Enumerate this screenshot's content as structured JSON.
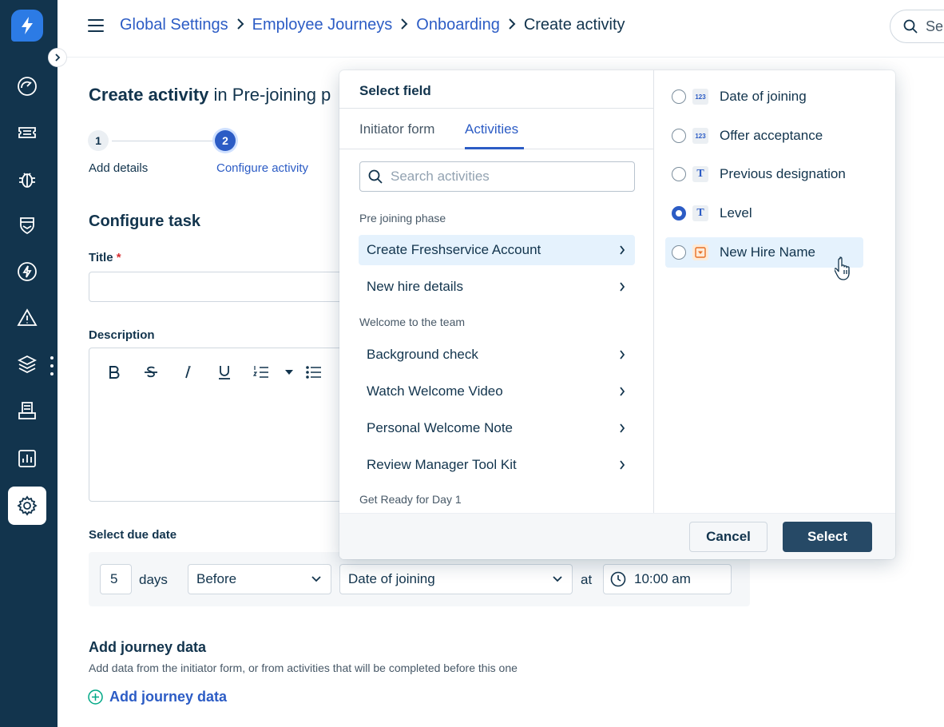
{
  "sidebar": {
    "items": [
      {
        "icon": "dashboard-icon"
      },
      {
        "icon": "tickets-icon"
      },
      {
        "icon": "bug-icon"
      },
      {
        "icon": "shield-icon"
      },
      {
        "icon": "lightning-icon"
      },
      {
        "icon": "alert-icon"
      },
      {
        "icon": "layers-icon"
      },
      {
        "icon": "inbox-icon"
      },
      {
        "icon": "reports-icon"
      },
      {
        "icon": "settings-icon",
        "active": true
      }
    ]
  },
  "header": {
    "breadcrumb": [
      "Global Settings",
      "Employee Journeys",
      "Onboarding"
    ],
    "current": "Create activity",
    "search_text": "Se"
  },
  "page": {
    "title_bold": "Create activity",
    "title_rest": "in Pre-joining p",
    "steps": [
      {
        "number": "1",
        "label": "Add details"
      },
      {
        "number": "2",
        "label": "Configure activity"
      }
    ],
    "section_title": "Configure task",
    "title_label": "Title",
    "required_mark": "*",
    "description_label": "Description",
    "due_date_label": "Select due date",
    "due": {
      "amount": "5",
      "unit": "days",
      "relation": "Before",
      "field": "Date of joining",
      "at": "at",
      "time": "10:00 am"
    },
    "journey": {
      "title": "Add journey data",
      "subtitle": "Add data from the initiator form, or from activities that will be completed before this one",
      "add_label": "Add journey data"
    }
  },
  "popover": {
    "title": "Select field",
    "tabs": [
      "Initiator form",
      "Activities"
    ],
    "active_tab": "Activities",
    "search_placeholder": "Search activities",
    "groups": [
      {
        "label": "Pre joining phase",
        "items": [
          "Create Freshservice Account",
          "New hire details"
        ]
      },
      {
        "label": "Welcome to the team",
        "items": [
          "Background check",
          "Watch Welcome Video",
          "Personal Welcome Note",
          "Review Manager Tool Kit"
        ]
      },
      {
        "label": "Get Ready for Day 1",
        "items": []
      }
    ],
    "fields": [
      {
        "name": "Date of joining",
        "type": "number",
        "type_label": "123",
        "selected": false
      },
      {
        "name": "Offer acceptance",
        "type": "number",
        "type_label": "123",
        "selected": false
      },
      {
        "name": "Previous designation",
        "type": "text",
        "type_label": "T",
        "selected": false
      },
      {
        "name": "Level",
        "type": "text",
        "type_label": "T",
        "selected": true
      },
      {
        "name": "New Hire Name",
        "type": "dropdown",
        "type_label": "",
        "selected": false,
        "hovered": true
      }
    ],
    "cancel_label": "Cancel",
    "select_label": "Select"
  },
  "colors": {
    "sidebar": "#12344d",
    "link": "#2c5cc5",
    "highlight": "#e5f2fd",
    "primary_button": "#264966"
  }
}
